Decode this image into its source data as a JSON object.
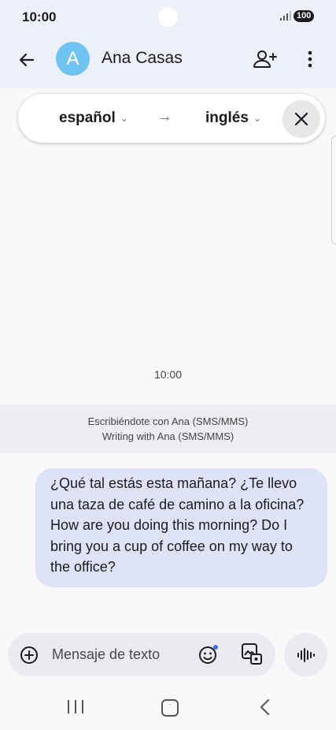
{
  "status_bar": {
    "time": "10:00",
    "battery": "100"
  },
  "conversation": {
    "contact_name": "Ana Casas",
    "avatar_initial": "A"
  },
  "translation": {
    "from_language": "español",
    "arrow": "→",
    "to_language": "inglés"
  },
  "thread": {
    "timestamp": "10:00",
    "info_line_1": "Escribiéndote con Ana (SMS/MMS)",
    "info_line_2": "Writing with Ana (SMS/MMS)",
    "messages": [
      {
        "original": "¿Qué tal estás esta mañana? ¿Te llevo una taza de café de camino a la oficina?",
        "translated": "How are you doing this morning? Do I bring you a cup of coffee on my way to the office?"
      }
    ]
  },
  "compose": {
    "placeholder": "Mensaje de texto"
  },
  "colors": {
    "accent": "#6fc3f0",
    "bubble": "#dfe3f8",
    "app_bar": "#eef0f8"
  }
}
